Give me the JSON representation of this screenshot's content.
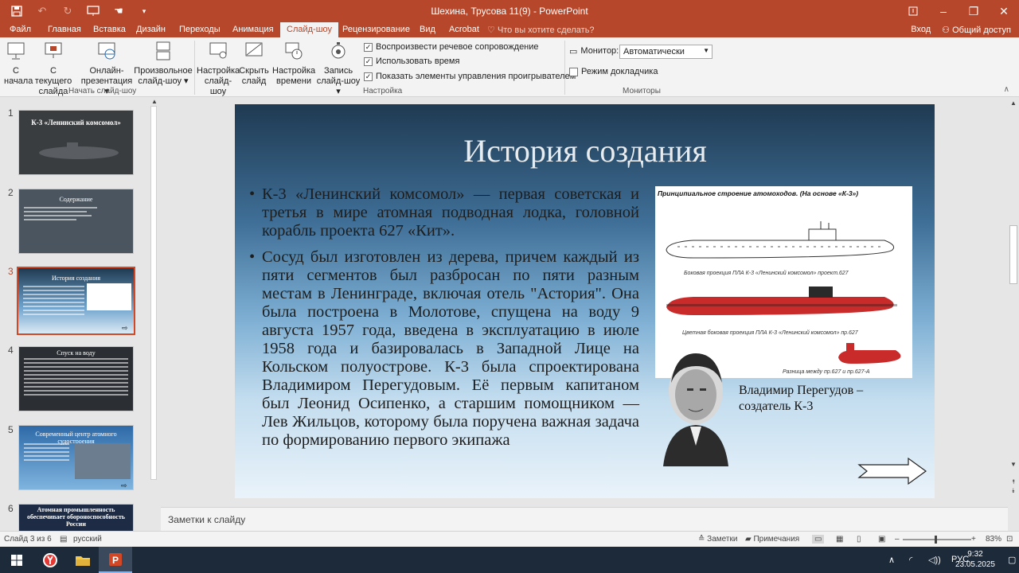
{
  "window": {
    "title": "Шехина, Трусова 11(9) - PowerPoint"
  },
  "tabs": {
    "items": [
      "Файл",
      "Главная",
      "Вставка",
      "Дизайн",
      "Переходы",
      "Анимация",
      "Слайд-шоу",
      "Рецензирование",
      "Вид",
      "Acrobat"
    ],
    "active": "Слайд-шоу",
    "tell_me": "Что вы хотите сделать?",
    "login": "Вход",
    "share": "Общий доступ"
  },
  "ribbon": {
    "start_group": {
      "label": "Начать слайд-шоу",
      "from_start": [
        "С",
        "начала"
      ],
      "from_current": [
        "С текущего",
        "слайда"
      ],
      "online": [
        "Онлайн-",
        "презентация ▾"
      ],
      "custom": [
        "Произвольное",
        "слайд-шоу ▾"
      ]
    },
    "setup_group": {
      "label": "Настройка",
      "setup": [
        "Настройка",
        "слайд-шоу"
      ],
      "hide": [
        "Скрыть",
        "слайд"
      ],
      "rehearse": [
        "Настройка",
        "времени"
      ],
      "record": [
        "Запись",
        "слайд-шоу ▾"
      ],
      "check_narration": "Воспроизвести речевое сопровождение",
      "check_timings": "Использовать время",
      "check_controls": "Показать элементы управления проигрывателем"
    },
    "monitors_group": {
      "label": "Мониторы",
      "monitor_label": "Монитор:",
      "monitor_value": "Автоматически",
      "presenter_view": "Режим докладчика"
    }
  },
  "thumbnails": [
    {
      "num": "1",
      "title": "К-3 «Ленинский комсомол»",
      "bg": "#3a3d40",
      "selected": false
    },
    {
      "num": "2",
      "title": "Содержание",
      "bg": "#4a5560",
      "selected": false
    },
    {
      "num": "3",
      "title": "История создания",
      "bg": "#35658f",
      "selected": true
    },
    {
      "num": "4",
      "title": "Спуск на воду",
      "bg": "#2b2f33",
      "selected": false
    },
    {
      "num": "5",
      "title": "Современный центр атомного судостроения",
      "bg": "#2e6aa8",
      "selected": false
    },
    {
      "num": "6",
      "title": "Атомная промышленность обеспечивает обороноспособность России",
      "bg": "#1d2b45",
      "selected": false
    }
  ],
  "slide": {
    "title": "История создания",
    "bullets": [
      "К-3 «Ленинский комсомол» — первая советская и третья в мире атомная подводная лодка, головной корабль проекта 627 «Кит».",
      "Сосуд был изготовлен из дерева, причем каждый из пяти сегментов был разбросан по пяти разным местам в Ленинграде, включая отель \"Астория\". Она была построена в Молотове, спущена на воду 9 августа 1957 года, введена в эксплуатацию в июле 1958 года и базировалась в Западной Лице на Кольском полуострове. К-3 была спроектирована Владимиром Перегудовым. Её первым капитаном был Леонид Осипенко, а старшим помощником — Лев Жильцов, которому была поручена важная задача по формированию первого экипажа"
    ],
    "scheme": {
      "heading": "Принципиальное строение атомоходов. (На основе «К-3»)",
      "caption1": "Боковая проекция ПЛА К-3 «Ленинский комсомол» проект.627",
      "caption2": "Цветная боковая проекция ПЛА К-3 «Ленинский комсомол» пр.627",
      "caption3": "Разница между пр.627 и пр.627-А"
    },
    "portrait_caption": "Владимир Перегудов – создатель К-3"
  },
  "notes": {
    "placeholder": "Заметки к слайду"
  },
  "status": {
    "slide_of": "Слайд 3 из 6",
    "language": "русский",
    "notes_btn": "Заметки",
    "comments_btn": "Примечания",
    "zoom": "83%"
  },
  "taskbar": {
    "lang": "РУС",
    "time": "9:32",
    "date": "23.05.2025"
  }
}
